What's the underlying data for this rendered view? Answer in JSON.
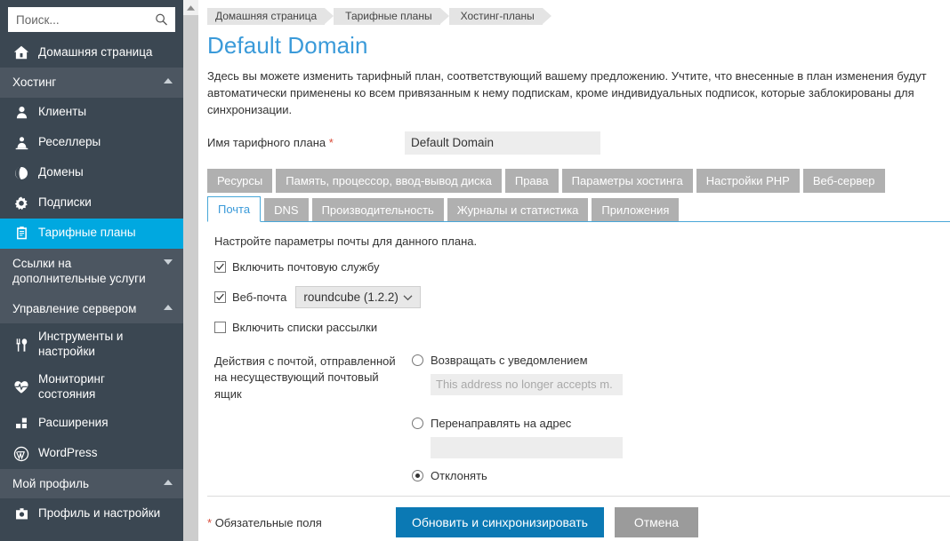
{
  "sidebar": {
    "search": {
      "placeholder": "Поиск...",
      "value": "",
      "icon": "search-icon"
    },
    "home": {
      "label": "Домашняя страница",
      "icon": "home-icon"
    },
    "hosting_section": {
      "label": "Хостинг",
      "caret": "chevron-up-icon"
    },
    "hosting_items": [
      {
        "label": "Клиенты",
        "icon": "user-icon"
      },
      {
        "label": "Реселлеры",
        "icon": "reseller-icon"
      },
      {
        "label": "Домены",
        "icon": "globe-icon"
      },
      {
        "label": "Подписки",
        "icon": "gear-icon"
      },
      {
        "label": "Тарифные планы",
        "icon": "clipboard-icon"
      }
    ],
    "links_section": {
      "label": "Ссылки на\nдополнительные услуги",
      "caret": "chevron-down-icon"
    },
    "server_section": {
      "label": "Управление сервером",
      "caret": "chevron-up-icon"
    },
    "server_items": [
      {
        "label": "Инструменты и\nнастройки",
        "icon": "tools-icon"
      },
      {
        "label": "Мониторинг\nсостояния",
        "icon": "heartbeat-icon"
      },
      {
        "label": "Расширения",
        "icon": "extensions-icon"
      },
      {
        "label": "WordPress",
        "icon": "wordpress-icon"
      }
    ],
    "profile_section": {
      "label": "Мой профиль",
      "caret": "chevron-up-icon"
    },
    "profile_items": [
      {
        "label": "Профиль и настройки",
        "icon": "profile-icon"
      }
    ]
  },
  "breadcrumb": [
    {
      "label": "Домашняя страница"
    },
    {
      "label": "Тарифные планы"
    },
    {
      "label": "Хостинг-планы"
    }
  ],
  "page": {
    "title": "Default Domain",
    "description": "Здесь вы можете изменить тарифный план, соответствующий вашему предложению. Учтите, что внесенные в план изменения будут автоматически применены ко всем привязанным к нему подпискам, кроме индивидуальных подписок, которые заблокированы для синхронизации.",
    "plan_name_label": "Имя тарифного плана",
    "required_mark": "*",
    "plan_name_value": "Default Domain",
    "plan_name_placeholder": ""
  },
  "tabs_row1": [
    {
      "label": "Ресурсы",
      "active": false
    },
    {
      "label": "Память, процессор, ввод-вывод диска",
      "active": false
    },
    {
      "label": "Права",
      "active": false
    },
    {
      "label": "Параметры хостинга",
      "active": false
    },
    {
      "label": "Настройки PHP",
      "active": false
    },
    {
      "label": "Веб-сервер",
      "active": false
    }
  ],
  "tabs_row2": [
    {
      "label": "Почта",
      "active": true
    },
    {
      "label": "DNS",
      "active": false
    },
    {
      "label": "Производительность",
      "active": false
    },
    {
      "label": "Журналы и статистика",
      "active": false
    },
    {
      "label": "Приложения",
      "active": false
    }
  ],
  "mail": {
    "intro": "Настройте параметры почты для данного плана.",
    "enable_mail": {
      "label": "Включить почтовую службу",
      "checked": true
    },
    "webmail": {
      "label": "Веб-почта",
      "checked": true,
      "selected": "roundcube (1.2.2)",
      "caret": "chevron-down-icon"
    },
    "mailing_lists": {
      "label": "Включить списки рассылки",
      "checked": false
    },
    "bounce_label": "Действия с почтой, отправленной на несуществующий почтовый ящик",
    "options": [
      {
        "label": "Возвращать с уведомлением",
        "selected": false,
        "has_input": true,
        "input_value": "",
        "input_placeholder": "This address no longer accepts m."
      },
      {
        "label": "Перенаправлять на адрес",
        "selected": false,
        "has_input": true,
        "input_value": "",
        "input_placeholder": ""
      },
      {
        "label": "Отклонять",
        "selected": true,
        "has_input": false,
        "input_value": "",
        "input_placeholder": ""
      }
    ]
  },
  "footer": {
    "required_note_mark": "*",
    "required_note": "Обязательные поля",
    "primary_button": "Обновить и синхронизировать",
    "secondary_button": "Отмена"
  },
  "colors": {
    "sidebar_bg": "#3b4752",
    "sidebar_section_bg": "#4c5661",
    "accent_active": "#00a8e0",
    "title_blue": "#3a9ad9",
    "primary_button": "#0b79b4",
    "secondary_button": "#9b9b9b",
    "required_red": "#d94a38",
    "tab_inactive": "#b0b0b0",
    "input_bg": "#ededed"
  }
}
